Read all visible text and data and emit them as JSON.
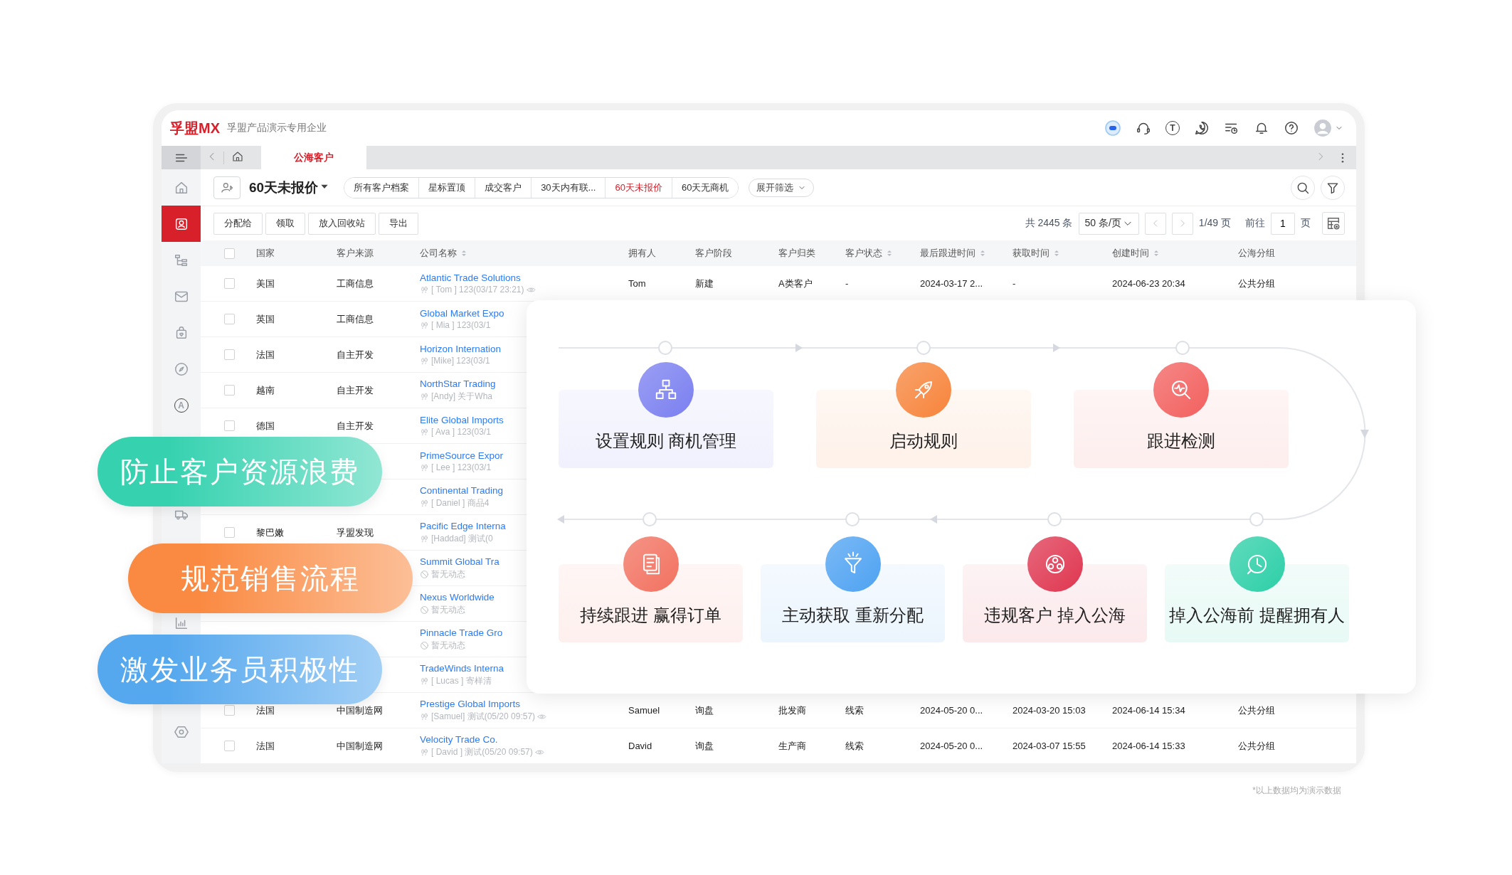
{
  "header": {
    "logo": "孚盟MX",
    "company": "孚盟产品演示专用企业",
    "tool_glyph": "T"
  },
  "tabs": [
    {
      "label": "公海客户",
      "selected": true
    }
  ],
  "sidebar": {
    "items": [
      {
        "selected": false
      },
      {
        "selected": true
      },
      {
        "selected": false
      },
      {
        "selected": false
      },
      {
        "selected": false
      },
      {
        "selected": false
      },
      {
        "selected": false,
        "glyph": "A"
      },
      {
        "selected": false
      },
      {
        "selected": false
      },
      {
        "selected": false
      }
    ]
  },
  "view": {
    "title": "60天未报价"
  },
  "quick_filters": [
    {
      "label": "所有客户档案",
      "selected": false
    },
    {
      "label": "星标置顶",
      "selected": false
    },
    {
      "label": "成交客户",
      "selected": false
    },
    {
      "label": "30天内有联...",
      "selected": false
    },
    {
      "label": "60天未报价",
      "selected": true
    },
    {
      "label": "60天无商机",
      "selected": false
    }
  ],
  "expand_filter": "展开筛选",
  "actions": [
    "分配给",
    "领取",
    "放入回收站",
    "导出"
  ],
  "pagination": {
    "total": "共 2445 条",
    "page_size": "50 条/页",
    "page_info": "1/49 页",
    "goto_label": "前往",
    "goto_value": "1",
    "page_suffix": "页"
  },
  "table": {
    "all_checked": false,
    "columns": [
      {
        "label": "国家",
        "sortable": false
      },
      {
        "label": "客户来源",
        "sortable": false
      },
      {
        "label": "公司名称",
        "sortable": true
      },
      {
        "label": "拥有人",
        "sortable": false
      },
      {
        "label": "客户阶段",
        "sortable": false
      },
      {
        "label": "客户归类",
        "sortable": false
      },
      {
        "label": "客户状态",
        "sortable": true
      },
      {
        "label": "最后跟进时间",
        "sortable": true
      },
      {
        "label": "获取时间",
        "sortable": true
      },
      {
        "label": "创建时间",
        "sortable": true
      },
      {
        "label": "公海分组",
        "sortable": false
      }
    ],
    "rows": [
      {
        "checked": false,
        "country": "美国",
        "source": "工商信息",
        "company": "Atlantic Trade Solutions",
        "kind": "activity",
        "note": "[ Tom ] 123(03/17 23:21)",
        "eye": true,
        "cells": [
          "Tom",
          "新建",
          "A类客户",
          "-",
          "2024-03-17 2...",
          "-",
          "2024-06-23 20:34",
          "公共分组"
        ]
      },
      {
        "checked": false,
        "country": "英国",
        "source": "工商信息",
        "company": "Global Market Expo",
        "kind": "activity",
        "note": "[ Mia ] 123(03/1",
        "eye": false
      },
      {
        "checked": false,
        "country": "法国",
        "source": "自主开发",
        "company": "Horizon Internation",
        "kind": "activity",
        "note": "[Mike] 123(03/1",
        "eye": false
      },
      {
        "checked": false,
        "country": "越南",
        "source": "自主开发",
        "company": "NorthStar Trading",
        "kind": "activity",
        "note": "[Andy] 关于Wha",
        "eye": false
      },
      {
        "checked": false,
        "country": "德国",
        "source": "自主开发",
        "company": "Elite Global Imports",
        "kind": "activity",
        "note": "[ Ava ] 123(03/1",
        "eye": false
      },
      {
        "company": "PrimeSource Expor",
        "kind": "activity",
        "note": "[ Lee ] 123(03/1",
        "eye": false
      },
      {
        "company": "Continental Trading",
        "kind": "activity",
        "note": "[ Daniel ] 商品4",
        "eye": false
      },
      {
        "checked": false,
        "country": "黎巴嫩",
        "source": "孚盟发现",
        "company": "Pacific Edge Interna",
        "kind": "activity",
        "note": "[Haddad] 测试(0",
        "eye": false
      },
      {
        "company": "Summit Global Tra",
        "kind": "empty",
        "note": "暂无动态",
        "eye": false
      },
      {
        "company": "Nexus Worldwide",
        "kind": "empty",
        "note": "暂无动态",
        "eye": false
      },
      {
        "company": "Pinnacle Trade Gro",
        "kind": "empty",
        "note": "暂无动态",
        "eye": false
      },
      {
        "company": "TradeWinds Interna",
        "kind": "activity",
        "note": "[ Lucas ] 寄样清",
        "eye": false
      },
      {
        "checked": false,
        "country": "法国",
        "source": "中国制造网",
        "company": "Prestige Global Imports",
        "kind": "activity",
        "note": "[Samuel] 测试(05/20 09:57)",
        "eye": true,
        "cells": [
          "Samuel",
          "询盘",
          "批发商",
          "线索",
          "2024-05-20 0...",
          "2024-03-20 15:03",
          "2024-06-14 15:34",
          "公共分组"
        ]
      },
      {
        "checked": false,
        "country": "法国",
        "source": "中国制造网",
        "company": "Velocity Trade Co.",
        "kind": "activity",
        "note": "[ David ] 测试(05/20 09:57)",
        "eye": true,
        "cells": [
          "David",
          "询盘",
          "生产商",
          "线索",
          "2024-05-20 0...",
          "2024-03-07 15:55",
          "2024-06-14 15:33",
          "公共分组"
        ]
      }
    ]
  },
  "slogans": [
    {
      "text": "防止客户资源浪费",
      "color": "#36d2b0"
    },
    {
      "text": "规范销售流程",
      "color": "#fa8a42"
    },
    {
      "text": "激发业务员积极性",
      "color": "#56a8ee"
    }
  ],
  "flow": {
    "steps_top": [
      {
        "label": "设置规则 商机管理",
        "color": "#7a7ff0"
      },
      {
        "label": "启动规则",
        "color": "#f7843b"
      },
      {
        "label": "跟进检测",
        "color": "#f2605e"
      }
    ],
    "steps_bottom": [
      {
        "label": "持续跟进 赢得订单",
        "color": "#f2715f"
      },
      {
        "label": "主动获取 重新分配",
        "color": "#4ea2f2"
      },
      {
        "label": "违规客户 掉入公海",
        "color": "#df3650"
      },
      {
        "label": "掉入公海前 提醒拥有人",
        "color": "#2ccfa7"
      }
    ]
  },
  "footnote": "*以上数据均为演示数据"
}
